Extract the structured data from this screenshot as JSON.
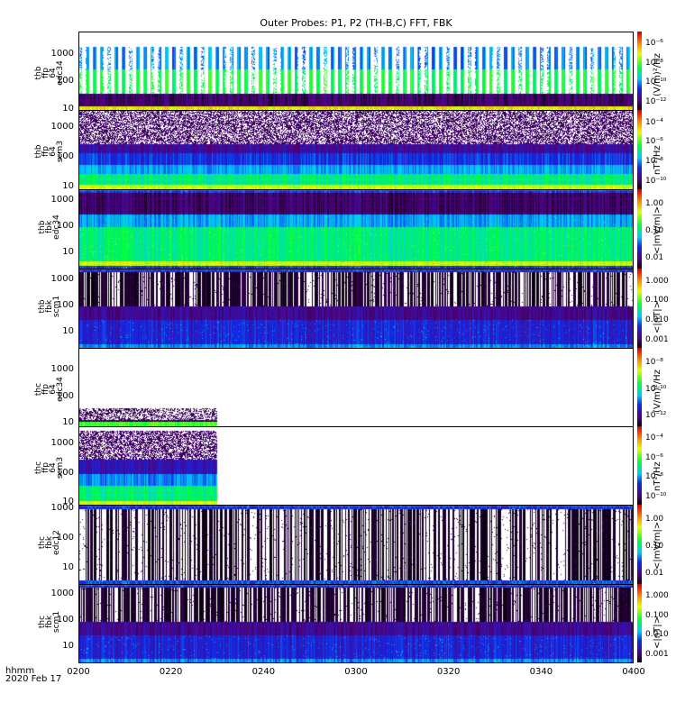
{
  "chart_data": {
    "type": "heatmap",
    "title": "Outer Probes: P1, P2 (TH-B,C) FFT, FBK",
    "x_axis": {
      "label_line1": "hhmm",
      "label_line2": "2020 Feb 17",
      "ticks": [
        "0200",
        "0220",
        "0240",
        "0300",
        "0320",
        "0340",
        "0400"
      ],
      "range_minutes": [
        0,
        120
      ]
    },
    "panels": [
      {
        "label": "thb\nffp\n64\nedc34",
        "ylim": [
          10,
          7000
        ],
        "yticks": [
          "10",
          "100",
          "1000"
        ],
        "ytick_values": [
          10,
          100,
          1000
        ],
        "cbar_ticks": [
          "10⁻¹²",
          "10⁻¹⁰",
          "10⁻⁸",
          "10⁻⁶"
        ],
        "cbar_unit": "(V/m)²/Hz",
        "data_end": 1.0,
        "style": "bursty",
        "bands": [
          {
            "f": [
              10,
              14
            ],
            "level": 0.75
          },
          {
            "f": [
              14,
              40
            ],
            "level": 0.1
          },
          {
            "f": [
              40,
              300
            ],
            "level": 0.55
          },
          {
            "f": [
              300,
              2000
            ],
            "level": 0.35
          }
        ]
      },
      {
        "label": "thb\nffp\n64\nscm3",
        "ylim": [
          9,
          4000
        ],
        "yticks": [
          "10",
          "100",
          "1000"
        ],
        "ytick_values": [
          10,
          100,
          1000
        ],
        "cbar_ticks": [
          "10⁻¹⁰",
          "10⁻⁸",
          "10⁻⁶",
          "10⁻⁴"
        ],
        "cbar_unit": "nT²/Hz",
        "data_end": 1.0,
        "style": "speckle",
        "bands": [
          {
            "f": [
              9,
              13
            ],
            "level": 0.7
          },
          {
            "f": [
              13,
              30
            ],
            "level": 0.5
          },
          {
            "f": [
              30,
              60
            ],
            "level": 0.38
          },
          {
            "f": [
              60,
              150
            ],
            "level": 0.28
          },
          {
            "f": [
              150,
              400
            ],
            "level": 0.17
          },
          {
            "f": [
              400,
              4000
            ],
            "level": 0.08
          }
        ]
      },
      {
        "label": "thb\nfbk\nedc34",
        "ylim": [
          2.5,
          2700
        ],
        "yticks": [
          "10",
          "100",
          "1000"
        ],
        "ytick_values": [
          10,
          100,
          1000
        ],
        "cbar_ticks": [
          "0.01",
          "0.10",
          "1.00"
        ],
        "cbar_unit": "<|mV/m|>",
        "data_end": 1.0,
        "style": "stripes",
        "bands": [
          {
            "f": [
              2.5,
              3.2
            ],
            "level": 0.28
          },
          {
            "f": [
              3.2,
              5
            ],
            "level": 0.7
          },
          {
            "f": [
              5,
              100
            ],
            "level": 0.5
          },
          {
            "f": [
              100,
              300
            ],
            "level": 0.37
          },
          {
            "f": [
              300,
              2000
            ],
            "level": 0.1
          },
          {
            "f": [
              2000,
              2700
            ],
            "level": 0.28
          }
        ]
      },
      {
        "label": "thb\nfbk\nscm1",
        "ylim": [
          2.5,
          2700
        ],
        "yticks": [
          "10",
          "100",
          "1000"
        ],
        "ytick_values": [
          10,
          100,
          1000
        ],
        "cbar_ticks": [
          "0.001",
          "0.010",
          "0.100",
          "1.000"
        ],
        "cbar_unit": "<|nT|>",
        "data_end": 1.0,
        "style": "stripes",
        "bands": [
          {
            "f": [
              2.5,
              3.5
            ],
            "level": 0.35
          },
          {
            "f": [
              3.5,
              30
            ],
            "level": 0.25
          },
          {
            "f": [
              30,
              100
            ],
            "level": 0.15
          },
          {
            "f": [
              100,
              2000
            ],
            "level": 0.02
          },
          {
            "f": [
              2000,
              2700
            ],
            "level": 0.27
          }
        ]
      },
      {
        "label": "thc\nffp\n64\nedc34",
        "ylim": [
          8,
          7000
        ],
        "yticks": [
          "10",
          "100",
          "1000"
        ],
        "ytick_values": [
          10,
          100,
          1000
        ],
        "cbar_ticks": [
          "10⁻¹²",
          "10⁻¹⁰",
          "10⁻⁸"
        ],
        "cbar_unit": "(V/m)²/Hz",
        "data_end": 0.25,
        "style": "sparse",
        "bands": [
          {
            "f": [
              8,
              12
            ],
            "level": 0.6
          },
          {
            "f": [
              12,
              40
            ],
            "level": 0.1
          }
        ]
      },
      {
        "label": "thc\nffp\n64\nscm3",
        "ylim": [
          9,
          4000
        ],
        "yticks": [
          "10",
          "100",
          "1000"
        ],
        "ytick_values": [
          10,
          100,
          1000
        ],
        "cbar_ticks": [
          "10⁻¹⁰",
          "10⁻⁸",
          "10⁻⁶",
          "10⁻⁴"
        ],
        "cbar_unit": "nT²/Hz",
        "data_end": 0.25,
        "style": "speckle",
        "bands": [
          {
            "f": [
              9,
              12
            ],
            "level": 0.7
          },
          {
            "f": [
              12,
              40
            ],
            "level": 0.5
          },
          {
            "f": [
              40,
              100
            ],
            "level": 0.35
          },
          {
            "f": [
              100,
              300
            ],
            "level": 0.2
          },
          {
            "f": [
              300,
              3000
            ],
            "level": 0.08
          }
        ]
      },
      {
        "label": "thc\nfbk\nedc12",
        "ylim": [
          3,
          1400
        ],
        "yticks": [
          "10",
          "100",
          "1000"
        ],
        "ytick_values": [
          10,
          100,
          1000
        ],
        "cbar_ticks": [
          "0.01",
          "0.10",
          "1.00"
        ],
        "cbar_unit": "<|mV/m|>",
        "data_end": 1.0,
        "style": "stripes",
        "bands": [
          {
            "f": [
              3,
              4.2
            ],
            "level": 0.3
          },
          {
            "f": [
              4.2,
              1000
            ],
            "level": 0.0
          },
          {
            "f": [
              1000,
              1400
            ],
            "level": 0.27
          }
        ]
      },
      {
        "label": "thc\nfbk\nscm1",
        "ylim": [
          2.5,
          2700
        ],
        "yticks": [
          "10",
          "100",
          "1000"
        ],
        "ytick_values": [
          10,
          100,
          1000
        ],
        "cbar_ticks": [
          "0.001",
          "0.010",
          "0.100",
          "1.000"
        ],
        "cbar_unit": "<|nT|>",
        "data_end": 1.0,
        "style": "stripes",
        "bands": [
          {
            "f": [
              2.5,
              3.5
            ],
            "level": 0.35
          },
          {
            "f": [
              3.5,
              30
            ],
            "level": 0.25
          },
          {
            "f": [
              30,
              100
            ],
            "level": 0.15
          },
          {
            "f": [
              100,
              2000
            ],
            "level": 0.02
          },
          {
            "f": [
              2000,
              2700
            ],
            "level": 0.27
          }
        ]
      }
    ]
  }
}
